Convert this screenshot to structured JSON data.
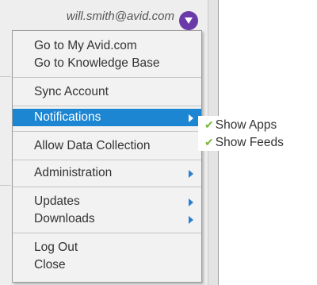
{
  "header": {
    "user_email": "will.smith@avid.com",
    "user_icon": "chevron-down-icon"
  },
  "menu": {
    "items": [
      {
        "label": "Go to My Avid.com"
      },
      {
        "label": "Go to Knowledge Base"
      },
      {
        "label": "Sync Account"
      },
      {
        "label": "Notifications",
        "has_submenu": true,
        "active": true
      },
      {
        "label": "Allow Data Collection"
      },
      {
        "label": "Administration",
        "has_submenu": true
      },
      {
        "label": "Updates",
        "has_submenu": true
      },
      {
        "label": "Downloads",
        "has_submenu": true
      },
      {
        "label": "Log Out"
      },
      {
        "label": "Close"
      }
    ]
  },
  "submenu": {
    "items": [
      {
        "label": "Show Apps",
        "checked": true
      },
      {
        "label": "Show Feeds",
        "checked": true
      }
    ]
  },
  "colors": {
    "active": "#1d86d2",
    "accent_purple": "#6a3aa8",
    "check_green": "#79b93b"
  }
}
